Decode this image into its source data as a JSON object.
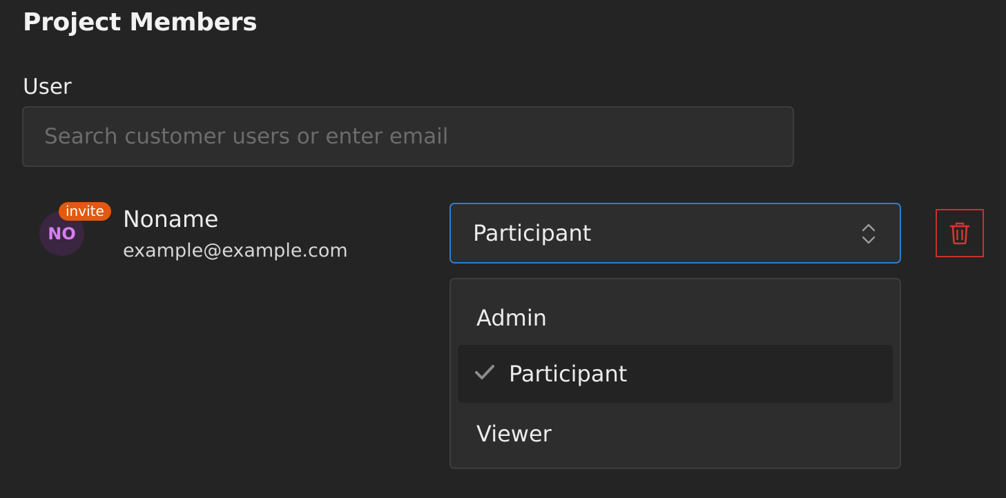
{
  "page": {
    "title": "Project Members"
  },
  "user_field": {
    "label": "User",
    "placeholder": "Search customer users or enter email",
    "value": ""
  },
  "member": {
    "initials": "NO",
    "badge": "invite",
    "name": "Noname",
    "email": "example@example.com",
    "role": "Participant"
  },
  "role_dropdown": {
    "options": [
      {
        "label": "Admin",
        "selected": false
      },
      {
        "label": "Participant",
        "selected": true
      },
      {
        "label": "Viewer",
        "selected": false
      }
    ]
  },
  "icons": {
    "select": "chevron-up-down-icon",
    "delete": "trash-icon",
    "selected_option": "check-icon"
  },
  "colors": {
    "background": "#242424",
    "input_bg": "#2d2d2d",
    "focus_border": "#2a7fd0",
    "badge": "#e3590d",
    "avatar_bg": "#3a2640",
    "avatar_text": "#d77ef0",
    "danger": "#c9312c"
  }
}
